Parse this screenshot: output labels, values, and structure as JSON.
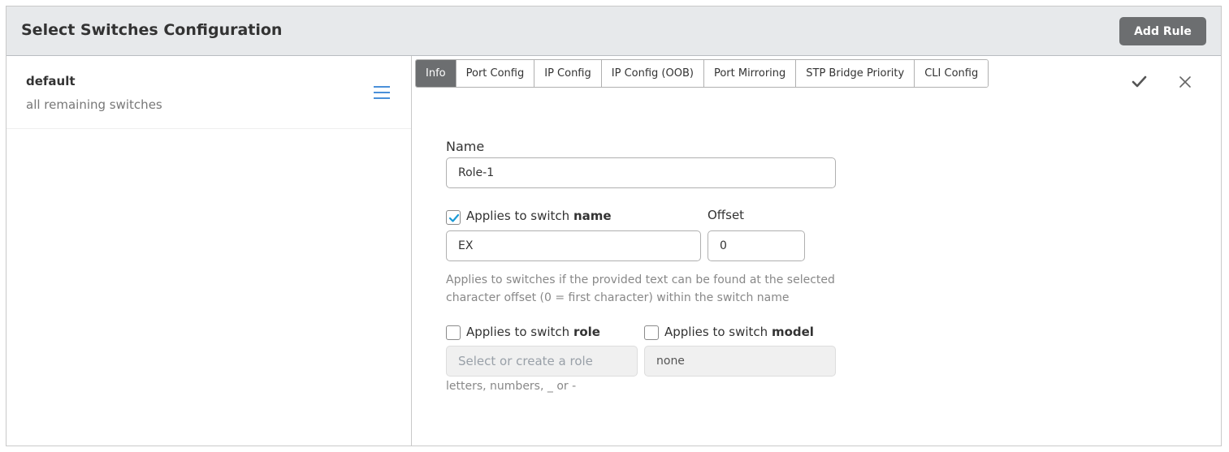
{
  "header": {
    "title": "Select Switches Configuration",
    "add_rule_label": "Add Rule"
  },
  "rules": [
    {
      "name": "default",
      "description": "all remaining switches"
    }
  ],
  "tabs": [
    {
      "label": "Info",
      "active": true
    },
    {
      "label": "Port Config"
    },
    {
      "label": "IP Config"
    },
    {
      "label": "IP Config (OOB)"
    },
    {
      "label": "Port Mirroring"
    },
    {
      "label": "STP Bridge Priority"
    },
    {
      "label": "CLI Config"
    }
  ],
  "form": {
    "name_label": "Name",
    "name_value": "Role-1",
    "switch_name": {
      "checked": true,
      "label_prefix": "Applies to switch ",
      "label_bold": "name",
      "value": "EX"
    },
    "offset": {
      "label": "Offset",
      "value": "0"
    },
    "help_line1": "Applies to switches if the provided text can be found at the selected",
    "help_line2": "character offset (0 = first character) within the switch name",
    "switch_role": {
      "checked": false,
      "label_prefix": "Applies to switch ",
      "label_bold": "role",
      "placeholder": "Select or create a role",
      "hint": "letters, numbers, _ or -"
    },
    "switch_model": {
      "checked": false,
      "label_prefix": "Applies to switch ",
      "label_bold": "model",
      "value": "none"
    }
  },
  "colors": {
    "accent": "#4a90d9",
    "checkbox_check": "#1a9ad6",
    "button_gray": "#6c6e70"
  }
}
